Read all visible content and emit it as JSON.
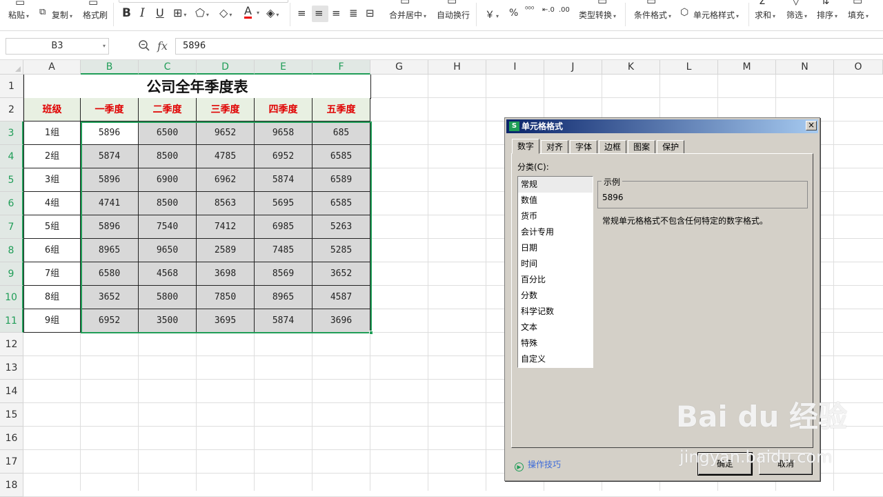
{
  "toolbar": {
    "paste": "粘贴",
    "copy": "复制",
    "format_painter": "格式刷",
    "bold": "B",
    "italic": "I",
    "underline": "U",
    "merge_center": "合并居中",
    "wrap_text": "自动换行",
    "currency": "￥",
    "percent": "%",
    "type_convert": "类型转换",
    "cond_format": "条件格式",
    "cell_style": "单元格样式",
    "sum": "求和",
    "filter": "筛选",
    "sort": "排序",
    "fill": "填充"
  },
  "formula_bar": {
    "name_box": "B3",
    "fx": "fx",
    "value": "5896"
  },
  "columns": [
    "A",
    "B",
    "C",
    "D",
    "E",
    "F",
    "G",
    "H",
    "I",
    "J",
    "K",
    "L",
    "M",
    "N",
    "O"
  ],
  "rows": [
    "1",
    "2",
    "3",
    "4",
    "5",
    "6",
    "7",
    "8",
    "9",
    "10",
    "11",
    "12",
    "13",
    "14",
    "15",
    "16",
    "17",
    "18"
  ],
  "sheet": {
    "title": "公司全年季度表",
    "headers": [
      "班级",
      "一季度",
      "二季度",
      "三季度",
      "四季度",
      "五季度"
    ],
    "groups": [
      "1组",
      "2组",
      "3组",
      "4组",
      "5组",
      "6组",
      "7组",
      "8组",
      "9组"
    ],
    "values": [
      [
        "5896",
        "6500",
        "9652",
        "9658",
        "685"
      ],
      [
        "5874",
        "8500",
        "4785",
        "6952",
        "6585"
      ],
      [
        "5896",
        "6900",
        "6962",
        "5874",
        "6589"
      ],
      [
        "4741",
        "8500",
        "8563",
        "5695",
        "6585"
      ],
      [
        "5896",
        "7540",
        "7412",
        "6985",
        "5263"
      ],
      [
        "8965",
        "9650",
        "2589",
        "7485",
        "5285"
      ],
      [
        "6580",
        "4568",
        "3698",
        "8569",
        "3652"
      ],
      [
        "3652",
        "5800",
        "7850",
        "8965",
        "4587"
      ],
      [
        "6952",
        "3500",
        "3695",
        "5874",
        "3696"
      ]
    ]
  },
  "dialog": {
    "logo": "S",
    "title": "单元格格式",
    "close": "×",
    "tabs": [
      "数字",
      "对齐",
      "字体",
      "边框",
      "图案",
      "保护"
    ],
    "category_label": "分类(C):",
    "categories": [
      "常规",
      "数值",
      "货币",
      "会计专用",
      "日期",
      "时间",
      "百分比",
      "分数",
      "科学记数",
      "文本",
      "特殊",
      "自定义"
    ],
    "sample_label": "示例",
    "sample_value": "5896",
    "description": "常规单元格格式不包含任何特定的数字格式。",
    "tips": "操作技巧",
    "ok": "确定",
    "cancel": "取消"
  },
  "watermark": {
    "brand": "Bai du 经验",
    "url": "jingyan.baidu.com"
  },
  "colors": {
    "accent_green": "#1f9d57",
    "header_red": "#e00000",
    "dialog_gray": "#d4d0c8"
  }
}
